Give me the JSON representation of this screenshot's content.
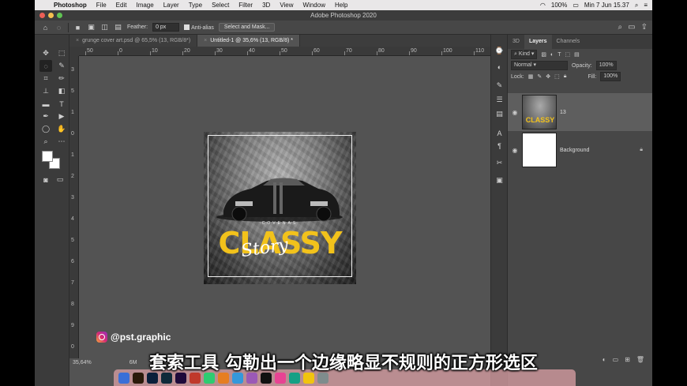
{
  "menubar": {
    "app_name": "Photoshop",
    "items": [
      "File",
      "Edit",
      "Image",
      "Layer",
      "Type",
      "Select",
      "Filter",
      "3D",
      "View",
      "Window",
      "Help"
    ],
    "battery": "100%",
    "datetime": "Min 7 Jun 15.37"
  },
  "window_title": "Adobe Photoshop 2020",
  "options": {
    "feather_label": "Feather:",
    "feather_value": "0 px",
    "anti_alias_label": "Anti-alias",
    "select_mask_label": "Select and Mask..."
  },
  "tabs": [
    {
      "label": "grunge cover art.psd @ 65,5% (13, RGB/8*)",
      "active": false
    },
    {
      "label": "Untitled-1 @ 35,6% (13, RGB/8) *",
      "active": true
    }
  ],
  "ruler_h": [
    "50",
    "0",
    "10",
    "20",
    "30",
    "40",
    "50",
    "60",
    "70",
    "80",
    "90",
    "100",
    "110",
    "120"
  ],
  "ruler_v": [
    "3",
    "5",
    "1",
    "0",
    "1",
    "2",
    "3",
    "4",
    "5",
    "6",
    "7",
    "8",
    "9",
    "0"
  ],
  "artwork": {
    "tagline": "COVENAS",
    "title": "CLASSY",
    "script": "Story"
  },
  "layers_panel": {
    "tabs": [
      "3D",
      "Layers",
      "Channels"
    ],
    "filter_label": "Kind",
    "blend_mode": "Normal",
    "opacity_label": "Opacity:",
    "opacity_value": "100%",
    "lock_label": "Lock:",
    "fill_label": "Fill:",
    "fill_value": "100%",
    "layers": [
      {
        "name": "13",
        "selected": true
      },
      {
        "name": "Background",
        "selected": false
      }
    ]
  },
  "status": {
    "zoom": "35,64%",
    "doc_size": "6M"
  },
  "overlay": {
    "instagram_handle": "@pst.graphic",
    "subtitle": "套索工具 勾勒出一个边缘略显不规则的正方形选区"
  },
  "colors": {
    "accent_yellow": "#f2c21b",
    "panel_bg": "#474747",
    "canvas_bg": "#535353"
  }
}
